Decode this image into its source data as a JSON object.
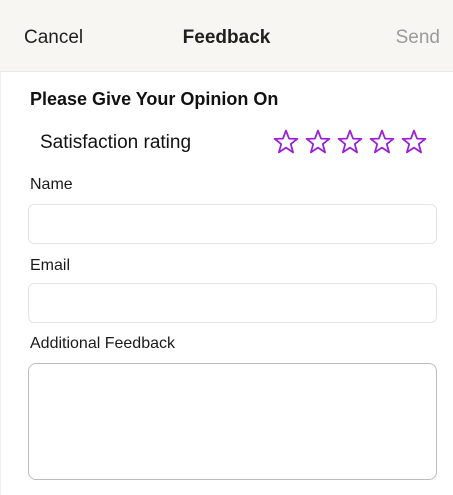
{
  "navbar": {
    "cancel_label": "Cancel",
    "title": "Feedback",
    "send_label": "Send"
  },
  "form": {
    "section_title": "Please Give Your Opinion On",
    "rating": {
      "label": "Satisfaction rating",
      "max_stars": 5,
      "value": 0,
      "star_icon": "star-outline-icon",
      "star_color": "#9b1fd6"
    },
    "name": {
      "label": "Name",
      "value": "",
      "placeholder": ""
    },
    "email": {
      "label": "Email",
      "value": "",
      "placeholder": ""
    },
    "additional_feedback": {
      "label": "Additional Feedback",
      "value": "",
      "placeholder": ""
    }
  },
  "colors": {
    "navbar_bg": "#f7f6f3",
    "send_disabled": "#9a9a9a",
    "accent_star": "#9b1fd6"
  }
}
